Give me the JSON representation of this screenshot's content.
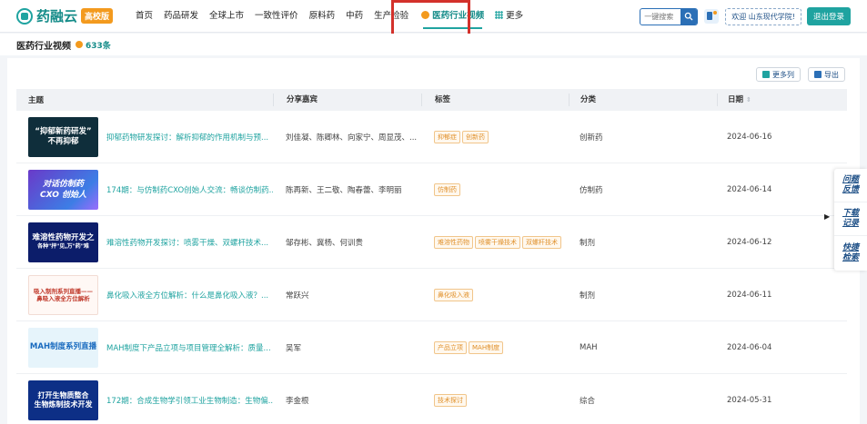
{
  "brand": {
    "name": "药融云",
    "badge": "高校版"
  },
  "nav": {
    "items": [
      {
        "label": "首页"
      },
      {
        "label": "药品研发"
      },
      {
        "label": "全球上市"
      },
      {
        "label": "一致性评价"
      },
      {
        "label": "原料药"
      },
      {
        "label": "中药"
      },
      {
        "label": "生产检验"
      }
    ],
    "active_label": "医药行业视频",
    "more_label": "更多"
  },
  "header": {
    "search_placeholder": "一键搜索",
    "welcome": "欢迎 山东现代学院!",
    "logout": "退出登录"
  },
  "page": {
    "title": "医药行业视频",
    "count": "633条"
  },
  "toolbar": {
    "more_columns": "更多列",
    "export": "导出"
  },
  "table": {
    "headers": {
      "topic": "主题",
      "guest": "分享嘉宾",
      "tags": "标签",
      "category": "分类",
      "date": "日期"
    },
    "rows": [
      {
        "thumb_lines": [
          "“抑郁新药研发”",
          "不再抑郁"
        ],
        "topic": "抑郁药物研发探讨：解析抑郁的作用机制与预...",
        "guest": "刘佳凝、陈卿林、向家宁、周显茂、...",
        "tags": [
          "抑郁症",
          "创新药"
        ],
        "category": "创新药",
        "date": "2024-06-16"
      },
      {
        "thumb_lines": [
          "对话仿制药",
          "CXO 创始人"
        ],
        "topic": "174期：与仿制药CXO创始人交流：畅谈仿制药...",
        "guest": "陈再新、王二敬、陶春蕾、李明丽",
        "tags": [
          "仿制药"
        ],
        "category": "仿制药",
        "date": "2024-06-14"
      },
      {
        "thumb_lines": [
          "难溶性药物开发之",
          "各种\"抨\"见,万\"药\"难"
        ],
        "topic": "难溶性药物开发探讨：喷雾干燥、双螺杆技术...",
        "guest": "邹存彬、冀杨、何训贵",
        "tags": [
          "难溶性药物",
          "喷雾干燥技术",
          "双螺杆技术"
        ],
        "category": "制剂",
        "date": "2024-06-12"
      },
      {
        "thumb_lines": [
          "吸入制剂系列直播——",
          "鼻吸入液全方位解析"
        ],
        "topic": "鼻化吸入液全方位解析：什么是鼻化吸入液？...",
        "guest": "常跃兴",
        "tags": [
          "鼻化吸入液"
        ],
        "category": "制剂",
        "date": "2024-06-11"
      },
      {
        "thumb_lines": [
          "MAH制度系列直播"
        ],
        "topic": "MAH制度下产品立项与项目管理全解析：质量...",
        "guest": "吴军",
        "tags": [
          "产品立项",
          "MAH制度"
        ],
        "category": "MAH",
        "date": "2024-06-04"
      },
      {
        "thumb_lines": [
          "打开生物质整合",
          "生物炼制技术开发"
        ],
        "topic": "172期：合成生物学引领工业生物制造：生物偏...",
        "guest": "李金根",
        "tags": [
          "技术探讨"
        ],
        "category": "综合",
        "date": "2024-05-31"
      }
    ]
  },
  "float_panel": {
    "items": [
      {
        "label": "问题反馈"
      },
      {
        "label": "下载记录"
      },
      {
        "label": "快捷检索"
      }
    ]
  },
  "colors": {
    "brand": "#1fa3a0",
    "accent": "#f39a1e",
    "highlight_box": "#d3312b",
    "link_blue": "#2b6fb6"
  }
}
